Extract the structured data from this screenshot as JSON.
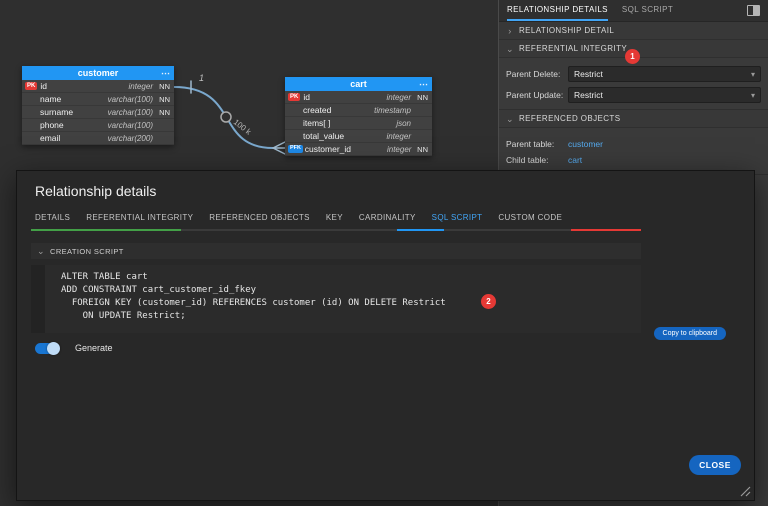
{
  "icons": {
    "chevron_right": "›",
    "chevron_down": "⌄",
    "caret_down": "▾",
    "table_menu": "⋯"
  },
  "canvas": {
    "tables": [
      {
        "name": "customer",
        "rows": [
          {
            "key": "PK",
            "name": "id",
            "type": "integer",
            "nn": "NN"
          },
          {
            "key": "",
            "name": "name",
            "type": "varchar(100)",
            "nn": "NN"
          },
          {
            "key": "",
            "name": "surname",
            "type": "varchar(100)",
            "nn": "NN"
          },
          {
            "key": "",
            "name": "phone",
            "type": "varchar(100)",
            "nn": ""
          },
          {
            "key": "",
            "name": "email",
            "type": "varchar(200)",
            "nn": ""
          }
        ]
      },
      {
        "name": "cart",
        "rows": [
          {
            "key": "PK",
            "name": "id",
            "type": "integer",
            "nn": "NN"
          },
          {
            "key": "",
            "name": "created",
            "type": "timestamp",
            "nn": ""
          },
          {
            "key": "",
            "name": "items[ ]",
            "type": "json",
            "nn": ""
          },
          {
            "key": "",
            "name": "total_value",
            "type": "integer",
            "nn": ""
          },
          {
            "key": "PFK",
            "name": "customer_id",
            "type": "integer",
            "nn": "NN"
          }
        ]
      }
    ],
    "relationship": {
      "cardinality": "1",
      "count_label": "100 k"
    }
  },
  "sidebar": {
    "tabs": [
      {
        "label": "RELATIONSHIP DETAILS"
      },
      {
        "label": "SQL SCRIPT"
      }
    ],
    "sections": {
      "relationship_detail": "RELATIONSHIP DETAIL",
      "referential_integrity": "REFERENTIAL INTEGRITY",
      "referenced_objects": "REFERENCED OBJECTS"
    },
    "badge": "1",
    "fields": [
      {
        "label": "Parent Delete:",
        "value": "Restrict"
      },
      {
        "label": "Parent Update:",
        "value": "Restrict"
      }
    ],
    "referenced": [
      {
        "label": "Parent table:",
        "value": "customer"
      },
      {
        "label": "Child table:",
        "value": "cart"
      }
    ]
  },
  "modal": {
    "title": "Relationship details",
    "tabs": [
      "DETAILS",
      "REFERENTIAL INTEGRITY",
      "REFERENCED OBJECTS",
      "KEY",
      "CARDINALITY",
      "SQL SCRIPT",
      "CUSTOM CODE"
    ],
    "section": "CREATION SCRIPT",
    "code": {
      "lines": [
        "ALTER TABLE cart",
        "ADD CONSTRAINT cart_customer_id_fkey",
        "  FOREIGN KEY (customer_id) REFERENCES customer (id) ON DELETE Restrict",
        "    ON UPDATE Restrict;"
      ]
    },
    "badge": "2",
    "generate_label": "Generate",
    "copy_button": "Copy to clipboard",
    "close_button": "CLOSE"
  },
  "colors": {
    "accent_blue": "#2196f3",
    "pk_red": "#e53935",
    "pfk_blue": "#1e88e5",
    "link_blue": "#55aaee"
  }
}
